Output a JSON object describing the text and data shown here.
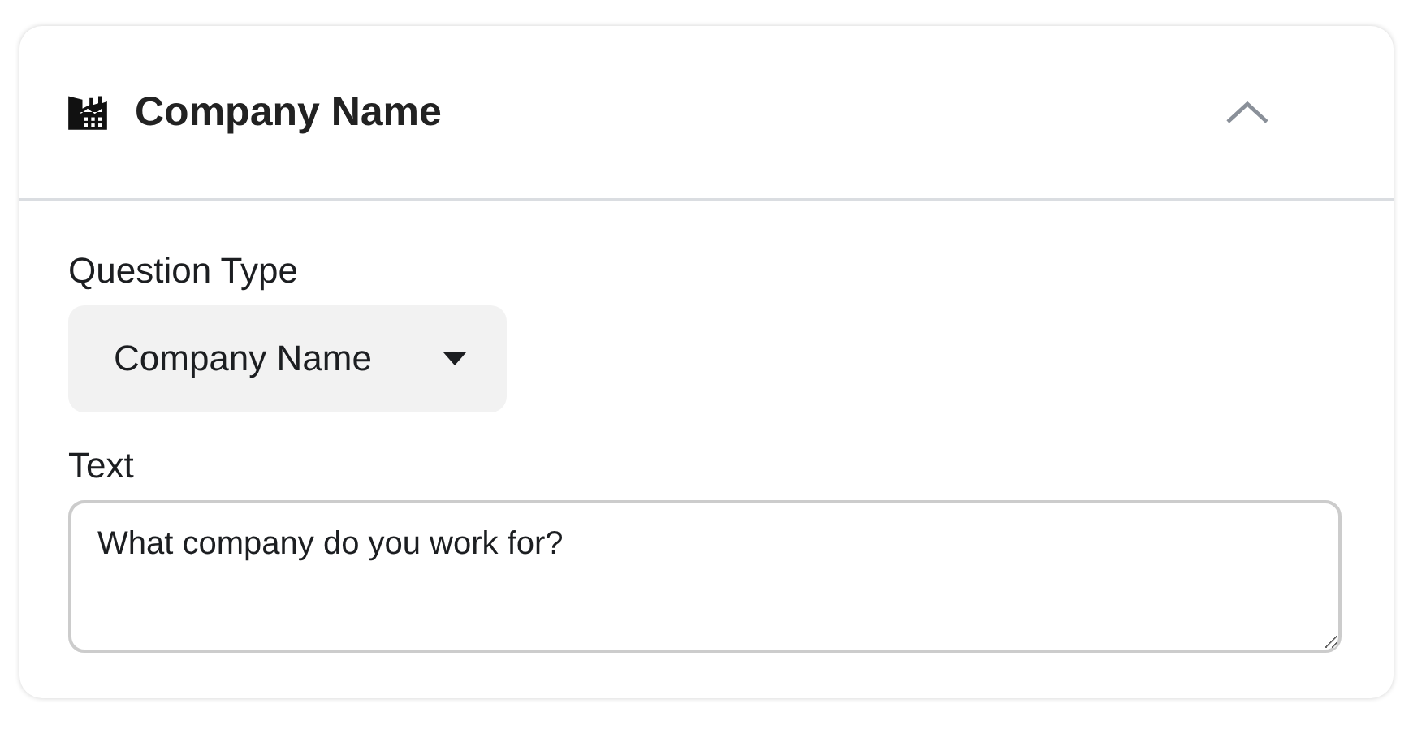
{
  "card": {
    "title": "Company Name",
    "expanded": true
  },
  "question_type": {
    "label": "Question Type",
    "value": "Company Name"
  },
  "text_field": {
    "label": "Text",
    "value": "What company do you work for?"
  }
}
